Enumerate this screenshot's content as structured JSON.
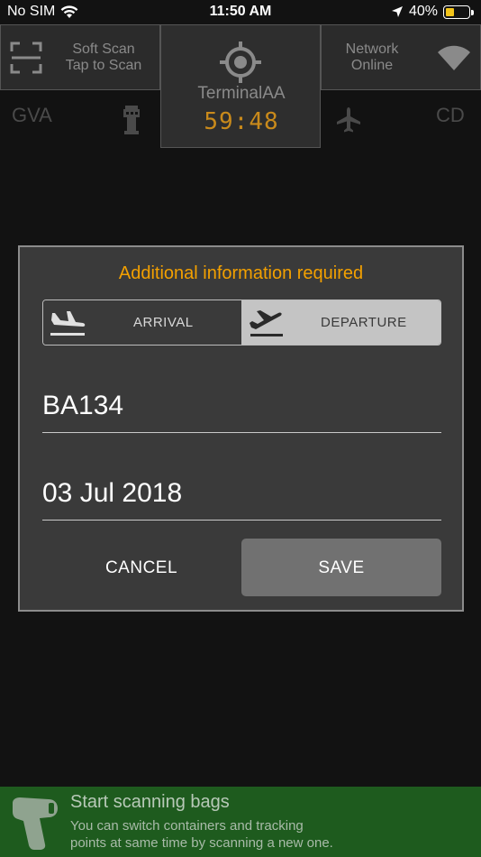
{
  "status_bar": {
    "carrier": "No SIM",
    "time": "11:50 AM",
    "battery": "40%",
    "battery_level": 0.4,
    "battery_color": "#f2c41a"
  },
  "header": {
    "soft_scan": {
      "line1": "Soft Scan",
      "line2": "Tap to Scan",
      "icon": "scan-frame-icon"
    },
    "terminal": {
      "name": "TerminalAA",
      "timer": "59:48",
      "icon": "target-icon"
    },
    "network": {
      "line1": "Network",
      "line2": "Online",
      "icon": "wifi-icon"
    },
    "route": {
      "origin": "GVA",
      "destination": "CD"
    }
  },
  "dialog": {
    "title": "Additional information required",
    "segments": {
      "arrival": {
        "label": "ARRIVAL",
        "icon": "plane-landing-icon",
        "selected": false
      },
      "departure": {
        "label": "DEPARTURE",
        "icon": "plane-takeoff-icon",
        "selected": true
      }
    },
    "flight_number": "BA134",
    "date": "03 Jul 2018",
    "cancel_label": "CANCEL",
    "save_label": "SAVE"
  },
  "banner": {
    "title": "Start scanning bags",
    "subtitle": "You can switch containers and tracking\n points at same time by scanning a new one.",
    "icon": "barcode-scanner-icon",
    "color": "#1e5b1e"
  },
  "colors": {
    "accent": "#f3a000",
    "timer": "#c98a1b",
    "background": "#121212"
  }
}
